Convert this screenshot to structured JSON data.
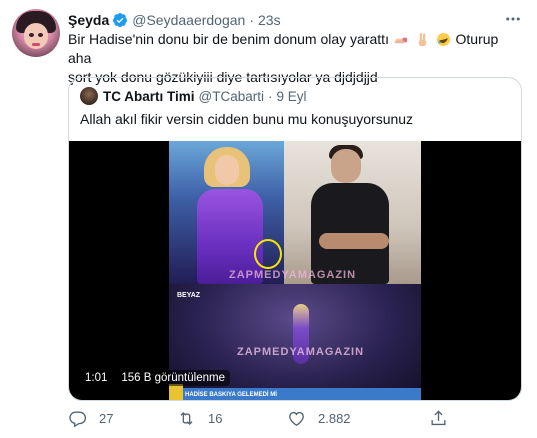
{
  "tweet": {
    "author_name": "Şeyda",
    "author_handle": "@Seydaaerdogan",
    "separator": "·",
    "time": "23s",
    "text_part1": "Bir Hadise'nin donu bir de benim donum olay yarattı",
    "text_part2": "Oturup aha",
    "text_line2": "şort yok donu gözükiyiii diye tartısıyolar ya djdjdjjd",
    "emojis": [
      "nail-polish-emoji",
      "victory-hand-emoji",
      "rofl-emoji"
    ]
  },
  "quote": {
    "author_name": "TC Abartı Timi",
    "author_handle": "@TCabarti",
    "separator": "·",
    "date": "9 Eyl",
    "text": "Allah akıl fikir versin cidden bunu mu konuşuyorsunuz",
    "video": {
      "duration": "1:01",
      "views": "156 B görüntülenme",
      "watermark": "ZAPMEDYAMAGAZIN",
      "channel_bug": "BEYAZ",
      "ticker": "HADİSE BASKIYA GELEMEDİ Mİ"
    }
  },
  "actions": {
    "reply_count": "27",
    "retweet_count": "16",
    "like_count": "2.882"
  },
  "colors": {
    "accent": "#1d9bf0",
    "secondary_text": "#536471",
    "border": "#cfd9de"
  }
}
